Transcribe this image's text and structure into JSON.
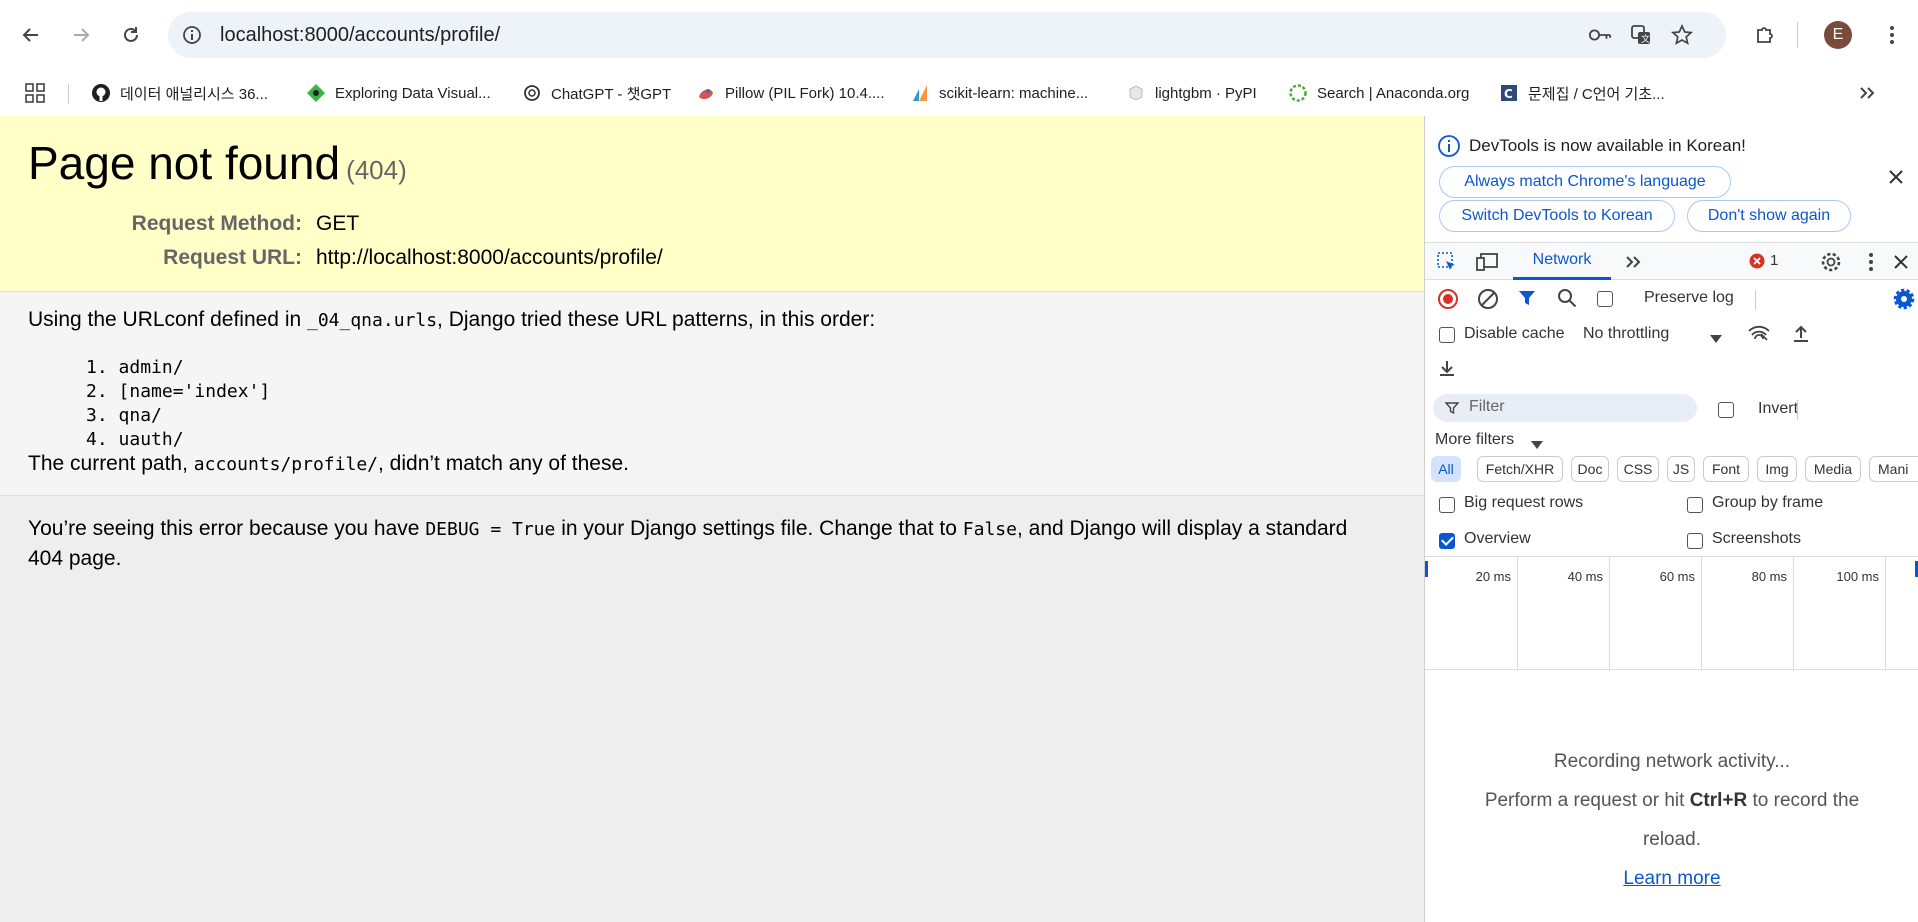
{
  "browser": {
    "url": "localhost:8000/accounts/profile/",
    "profile_initial": "E",
    "bookmarks": [
      {
        "label": "데이터 애널리시스 36...",
        "icon": "github-icon"
      },
      {
        "label": "Exploring Data Visual...",
        "icon": "green-diamond-icon"
      },
      {
        "label": "ChatGPT - 챗GPT",
        "icon": "chatgpt-icon"
      },
      {
        "label": "Pillow (PIL Fork) 10.4....",
        "icon": "pillow-icon"
      },
      {
        "label": "scikit-learn: machine...",
        "icon": "sklearn-icon"
      },
      {
        "label": "lightgbm · PyPI",
        "icon": "pypi-icon"
      },
      {
        "label": "Search | Anaconda.org",
        "icon": "anaconda-icon"
      },
      {
        "label": "문제집 / C언어 기초...",
        "icon": "c-logo-icon"
      }
    ]
  },
  "page": {
    "title": "Page not found",
    "status_code": "(404)",
    "request_method_label": "Request Method:",
    "request_method": "GET",
    "request_url_label": "Request URL:",
    "request_url": "http://localhost:8000/accounts/profile/",
    "urlconf_pre": "Using the URLconf defined in ",
    "urlconf_module": "_04_qna.urls",
    "urlconf_post": ", Django tried these URL patterns, in this order:",
    "patterns": [
      {
        "num": "1.",
        "pattern": "admin/"
      },
      {
        "num": "2.",
        "pattern": "[name='index']"
      },
      {
        "num": "3.",
        "pattern": "qna/"
      },
      {
        "num": "4.",
        "pattern": "uauth/"
      }
    ],
    "current_path_pre": "The current path, ",
    "current_path": "accounts/profile/",
    "current_path_post": ", didn’t match any of these.",
    "explain_1": "You’re seeing this error because you have ",
    "explain_code_1": "DEBUG = True",
    "explain_2": " in your Django settings file. Change that to ",
    "explain_code_2": "False",
    "explain_3": ", and Django will display a standard 404 page."
  },
  "devtools": {
    "infobar_message": "DevTools is now available in Korean!",
    "btn_always_match": "Always match Chrome's language",
    "btn_switch_korean": "Switch DevTools to Korean",
    "btn_dont_show": "Don't show again",
    "tab_network": "Network",
    "error_count": "1",
    "preserve_log": "Preserve log",
    "disable_cache": "Disable cache",
    "throttling": "No throttling",
    "filter_placeholder": "Filter",
    "invert": "Invert",
    "more_filters": "More filters",
    "chips": [
      "All",
      "Fetch/XHR",
      "Doc",
      "CSS",
      "JS",
      "Font",
      "Img",
      "Media",
      "Mani"
    ],
    "big_request_rows": "Big request rows",
    "group_by_frame": "Group by frame",
    "overview": "Overview",
    "overview_checked": true,
    "screenshots": "Screenshots",
    "timeline_ticks": [
      "20 ms",
      "40 ms",
      "60 ms",
      "80 ms",
      "100 ms"
    ],
    "empty_line1": "Recording network activity...",
    "empty_line2_pre": "Perform a request or hit ",
    "empty_shortcut": "Ctrl+R",
    "empty_line2_post": " to record the",
    "empty_line3": "reload.",
    "learn_more": "Learn more",
    "accent_color": "#0b57d0",
    "error_color": "#d93025"
  }
}
